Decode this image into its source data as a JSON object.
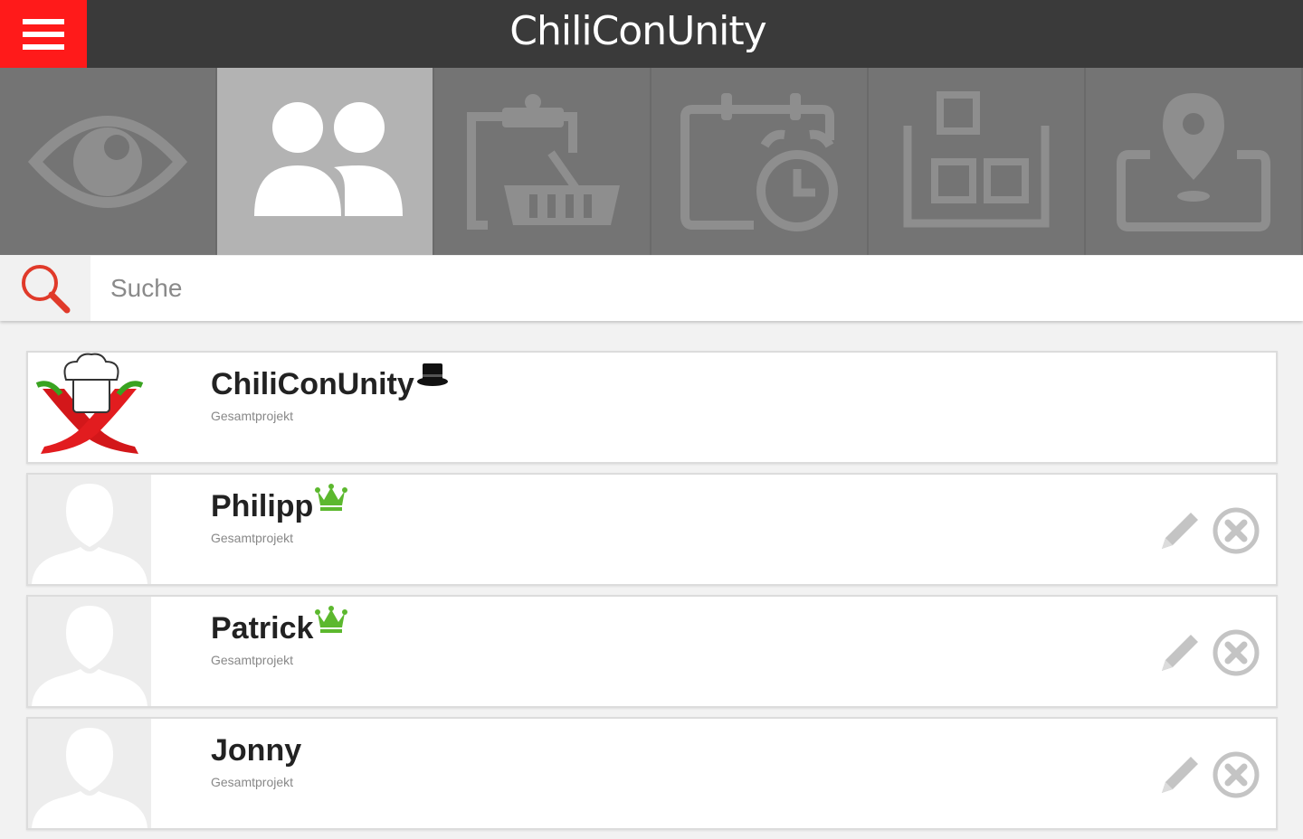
{
  "header": {
    "title": "ChiliConUnity",
    "menu_icon": "hamburger-icon",
    "accent_color": "#ff1a1a"
  },
  "tabs": [
    {
      "icon": "eye-icon",
      "active": false
    },
    {
      "icon": "users-icon",
      "active": true
    },
    {
      "icon": "shopping-list-icon",
      "active": false
    },
    {
      "icon": "calendar-alarm-icon",
      "active": false
    },
    {
      "icon": "board-icon",
      "active": false
    },
    {
      "icon": "location-icon",
      "active": false
    }
  ],
  "search": {
    "placeholder": "Suche",
    "value": ""
  },
  "members": [
    {
      "name": "ChiliConUnity",
      "role": "Gesamtprojekt",
      "badge": "top-hat-icon",
      "avatar": "chili-logo"
    },
    {
      "name": "Philipp",
      "role": "Gesamtprojekt",
      "badge": "crown-icon",
      "avatar": "default-user"
    },
    {
      "name": "Patrick",
      "role": "Gesamtprojekt",
      "badge": "crown-icon",
      "avatar": "default-user"
    },
    {
      "name": "Jonny",
      "role": "Gesamtprojekt",
      "badge": "",
      "avatar": "default-user"
    }
  ]
}
